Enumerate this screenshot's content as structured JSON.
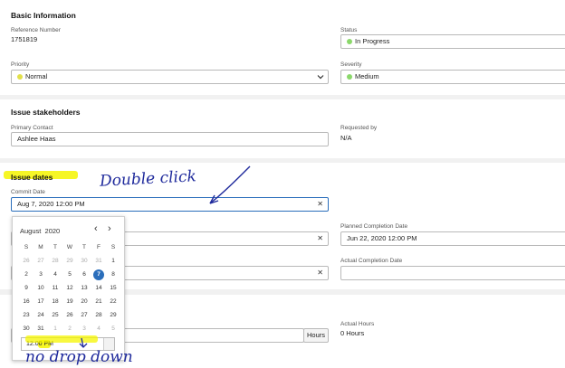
{
  "basic": {
    "title": "Basic Information",
    "reference_label": "Reference Number",
    "reference_value": "1751819",
    "status_label": "Status",
    "status_value": "In Progress",
    "status_color": "#8bd86b",
    "priority_label": "Priority",
    "priority_value": "Normal",
    "priority_color": "#e2e04a",
    "severity_label": "Severity",
    "severity_value": "Medium",
    "severity_color": "#8bd86b"
  },
  "stakeholders": {
    "title": "Issue stakeholders",
    "primary_label": "Primary Contact",
    "primary_value": "Ashlee Haas",
    "requested_label": "Requested by",
    "requested_value": "N/A"
  },
  "dates": {
    "title": "Issue dates",
    "commit_label": "Commit Date",
    "commit_value": "Aug 7, 2020 12:00 PM",
    "planned_label": "Planned Completion Date",
    "planned_value": "Jun 22, 2020 12:00 PM",
    "actual_label": "Actual Completion Date",
    "clear_symbol": "✕"
  },
  "hours": {
    "addon": "Hours",
    "actual_label": "Actual Hours",
    "actual_value": "0 Hours"
  },
  "calendar": {
    "month": "August",
    "year": "2020",
    "prev": "‹",
    "next": "›",
    "weekdays": [
      "S",
      "M",
      "T",
      "W",
      "T",
      "F",
      "S"
    ],
    "weeks": [
      [
        "26",
        "27",
        "28",
        "29",
        "30",
        "31",
        "1"
      ],
      [
        "2",
        "3",
        "4",
        "5",
        "6",
        "7",
        "8"
      ],
      [
        "9",
        "10",
        "11",
        "12",
        "13",
        "14",
        "15"
      ],
      [
        "16",
        "17",
        "18",
        "19",
        "20",
        "21",
        "22"
      ],
      [
        "23",
        "24",
        "25",
        "26",
        "27",
        "28",
        "29"
      ],
      [
        "30",
        "31",
        "1",
        "2",
        "3",
        "4",
        "5"
      ]
    ],
    "time_value": "12:00 PM"
  },
  "annotations": {
    "double_click": "Double click",
    "no_drop_down": "no drop down",
    "ink_color": "#1f2a9c",
    "highlight_color": "#f5f500"
  }
}
